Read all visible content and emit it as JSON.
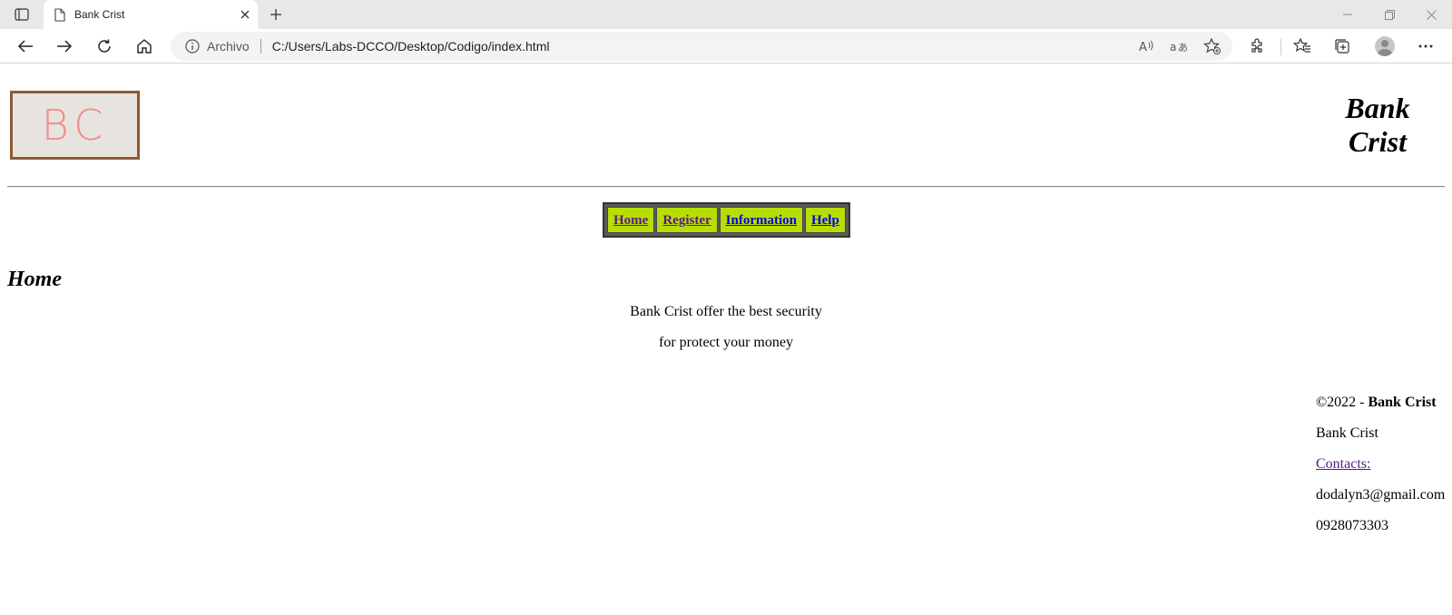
{
  "browser": {
    "tab_title": "Bank Crist",
    "address_prefix": "Archivo",
    "url": "C:/Users/Labs-DCCO/Desktop/Codigo/index.html"
  },
  "page": {
    "logo_text": "BC",
    "site_title_line1": "Bank",
    "site_title_line2": "Crist",
    "menu": [
      {
        "label": "Home"
      },
      {
        "label": "Register"
      },
      {
        "label": "Information"
      },
      {
        "label": "Help"
      }
    ],
    "heading": "Home",
    "intro": [
      "Bank Crist offer the best security",
      "for protect your money"
    ],
    "footer": {
      "copyright_prefix": "©2022 - ",
      "copyright_name": "Bank Crist",
      "company": "Bank Crist",
      "contacts_label": "Contacts:",
      "email": "dodalyn3@gmail.com",
      "phone": "0928073303"
    }
  },
  "colors": {
    "menu_bg": "#b7de00",
    "menu_frame": "#5a5a5a",
    "logo_letters": "#ee8f8f"
  }
}
